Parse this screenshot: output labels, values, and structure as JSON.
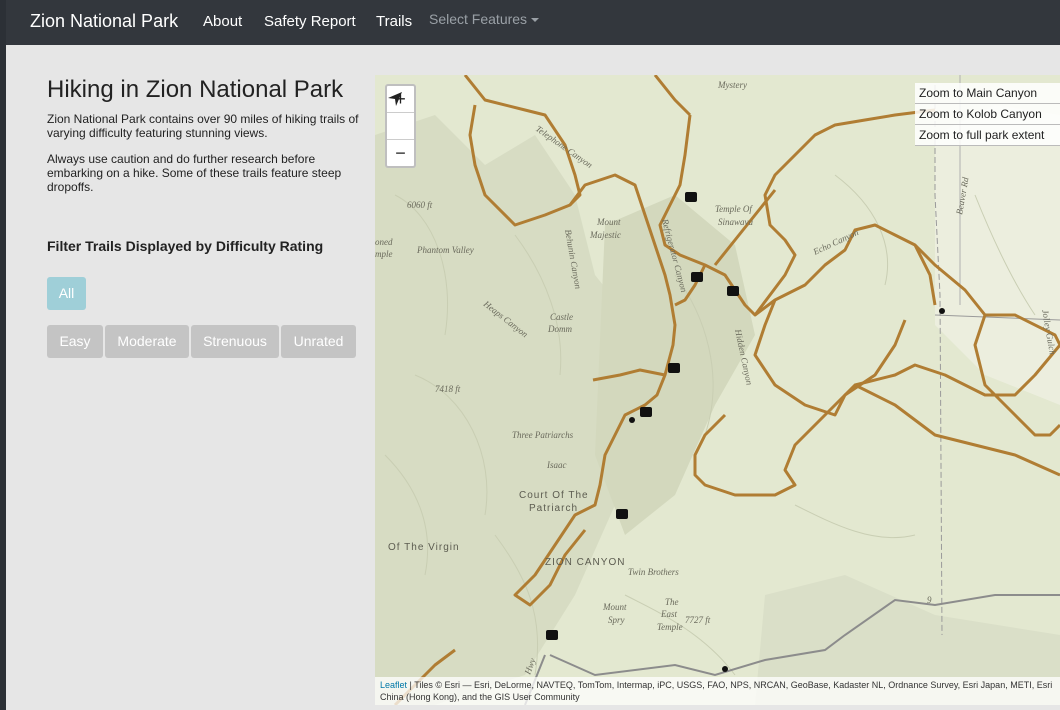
{
  "nav": {
    "brand": "Zion National Park",
    "about": "About",
    "safety": "Safety Report",
    "trails": "Trails",
    "features": "Select Features"
  },
  "sidebar": {
    "title": "Hiking in Zion National Park",
    "intro": "Zion National Park contains over 90 miles of hiking trails of varying difficulty featuring stunning views.",
    "caution": "Always use caution and do further research before embarking on a hike. Some of these trails feature steep dropoffs.",
    "filter_title": "Filter Trails Displayed by Difficulty Rating",
    "buttons": {
      "all": "All",
      "easy": "Easy",
      "moderate": "Moderate",
      "strenuous": "Strenuous",
      "unrated": "Unrated"
    }
  },
  "map": {
    "zoom_in": "+",
    "zoom_out": "−",
    "zoom_links": [
      "Zoom to Main Canyon",
      "Zoom to Kolob Canyon",
      "Zoom to full park extent"
    ],
    "attribution_link": "Leaflet",
    "attribution_text": " | Tiles © Esri — Esri, DeLorme, NAVTEQ, TomTom, Intermap, iPC, USGS, FAO, NPS, NRCAN, GeoBase, Kadaster NL, Ordnance Survey, Esri Japan, METI, Esri China (Hong Kong), and the GIS User Community",
    "labels": {
      "mystery": "Mystery",
      "telephone": "Telephone Canyon",
      "mount_majestic": "Mount",
      "mount_majestic2": "Majestic",
      "temple": "Temple Of",
      "temple2": "Sinawava",
      "phantom": "Phantom Valley",
      "behunin": "Behunin Canyon",
      "refrigerator": "Refrigerator Canyon",
      "castle": "Castle",
      "castle2": "Domm",
      "heaps": "Heaps Canyon",
      "hidden": "Hidden Canyon",
      "three": "Three Patriarchs",
      "isaac": "Isaac",
      "court": "Court Of The",
      "court2": "Patriarch",
      "virgin": "Of The Virgin",
      "zion": "ZION CANYON",
      "twin": "Twin Brothers",
      "spry": "Mount",
      "spry2": "Spry",
      "east": "The",
      "east2": "East",
      "east3": "Temple",
      "elev1": "6060 ft",
      "elev2": "7418 ft",
      "elev3": "7727 ft",
      "beaver": "Beaver Rd",
      "jolley": "Jolley Gulch",
      "echo": "Echo Canyon",
      "oned": "oned",
      "mple": "mple",
      "hwy": "Hwy",
      "route": "9"
    }
  }
}
